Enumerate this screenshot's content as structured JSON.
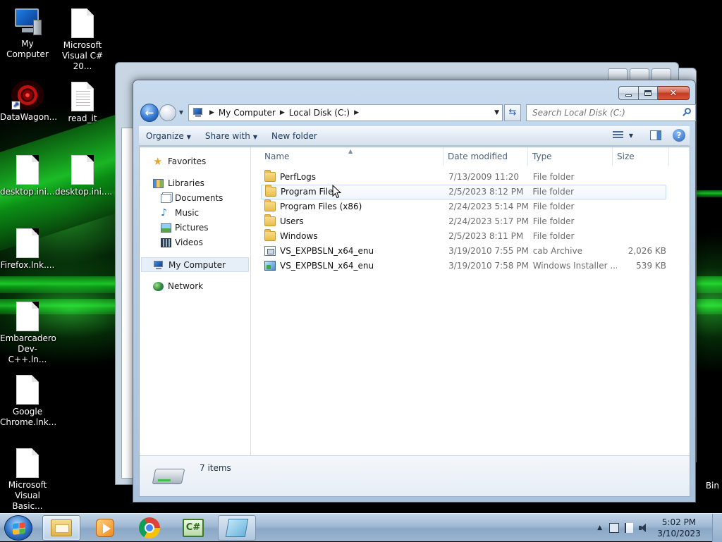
{
  "desktop": {
    "icons": [
      {
        "label": "My Computer",
        "icon": "computer-icon"
      },
      {
        "label": "Microsoft Visual C# 20...",
        "icon": "document-icon"
      },
      {
        "label": "DataWagon...",
        "icon": "datawagon-shortcut-icon"
      },
      {
        "label": "read_it",
        "icon": "text-file-icon"
      },
      {
        "label": "desktop.ini....",
        "icon": "document-icon"
      },
      {
        "label": "desktop.ini....",
        "icon": "document-icon"
      },
      {
        "label": "Firefox.lnk....",
        "icon": "document-icon"
      },
      {
        "label": "Embarcadero Dev-C++.ln...",
        "icon": "document-icon"
      },
      {
        "label": "Google Chrome.lnk...",
        "icon": "document-icon"
      },
      {
        "label": "Microsoft Visual Basic...",
        "icon": "document-icon"
      }
    ],
    "recycle_bin_partial_label": "Bin"
  },
  "explorer": {
    "breadcrumb": [
      "My Computer",
      "Local Disk (C:)"
    ],
    "search_placeholder": "Search Local Disk (C:)",
    "toolbar": {
      "organize": "Organize",
      "share_with": "Share with",
      "new_folder": "New folder"
    },
    "nav_pane": {
      "favorites": "Favorites",
      "libraries": "Libraries",
      "documents": "Documents",
      "music": "Music",
      "pictures": "Pictures",
      "videos": "Videos",
      "my_computer": "My Computer",
      "network": "Network"
    },
    "columns": {
      "name": "Name",
      "date_modified": "Date modified",
      "type": "Type",
      "size": "Size"
    },
    "files": [
      {
        "name": "PerfLogs",
        "date": "7/13/2009 11:20 PM",
        "type": "File folder",
        "size": "",
        "icon": "folder-icon"
      },
      {
        "name": "Program Files",
        "date": "2/5/2023 8:12 PM",
        "type": "File folder",
        "size": "",
        "icon": "folder-icon"
      },
      {
        "name": "Program Files (x86)",
        "date": "2/24/2023 5:14 PM",
        "type": "File folder",
        "size": "",
        "icon": "folder-icon"
      },
      {
        "name": "Users",
        "date": "2/24/2023 5:17 PM",
        "type": "File folder",
        "size": "",
        "icon": "folder-icon"
      },
      {
        "name": "Windows",
        "date": "2/5/2023 8:11 PM",
        "type": "File folder",
        "size": "",
        "icon": "folder-icon"
      },
      {
        "name": "VS_EXPBSLN_x64_enu",
        "date": "3/19/2010 7:55 PM",
        "type": "cab Archive",
        "size": "2,026 KB",
        "icon": "cab-archive-icon"
      },
      {
        "name": "VS_EXPBSLN_x64_enu",
        "date": "3/19/2010 7:58 PM",
        "type": "Windows Installer ...",
        "size": "539 KB",
        "icon": "installer-icon"
      }
    ],
    "hovered_row": "Program Files",
    "status": {
      "item_count": "7 items"
    }
  },
  "taskbar": {
    "apps": [
      {
        "name": "windows-explorer",
        "state": "active"
      },
      {
        "name": "windows-media-player",
        "state": "pinned"
      },
      {
        "name": "google-chrome",
        "state": "pinned"
      },
      {
        "name": "visual-csharp",
        "state": "pinned"
      },
      {
        "name": "notepad",
        "state": "open"
      }
    ],
    "clock": {
      "time": "5:02 PM",
      "date": "3/10/2023"
    }
  },
  "colors": {
    "wallpaper_accent": "#1ecf2a",
    "close_button": "#c33b22",
    "selection_border": "#c4d8ee"
  }
}
